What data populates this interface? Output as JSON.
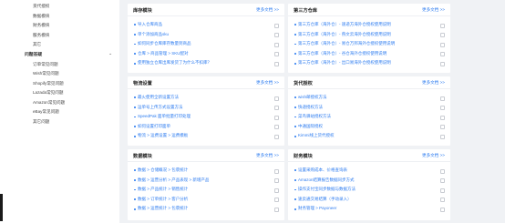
{
  "sidebar": {
    "top_items": [
      "货代授权",
      "数据模块",
      "财务模块",
      "服务模块",
      "其它"
    ],
    "group_label": "问题答疑",
    "group_items": [
      "订单常见问题",
      "Wish常见问题",
      "Shopify常见问题",
      "Lazada常见问题",
      "Amazon常见问题",
      "eBay常见问题",
      "其它问题"
    ]
  },
  "cards": [
    {
      "title": "库存模块",
      "more": "更多文档 >>",
      "rows": [
        "导入仓库商品",
        "单个添加商品sku",
        "如何同步仓库库存数量到商品",
        "仓库 > 商品管理 > SKU配对",
        "使用独立仓库出库发货了为什么不扣库？"
      ]
    },
    {
      "title": "第三方仓库",
      "more": "更多文档 >>",
      "rows": [
        "第三方仓库（海外仓）- 速递方海外仓授权使用说明",
        "第三方仓库（海外仓）- 燕文云海外仓授权使用说明",
        "第三方仓库（海外仓）- 易仓万邦海外仓授权使用说明",
        "第三方仓库（海外仓）- 谷仓海外仓授权使用说明",
        "第三方仓库（海外仓）- 出口易海外仓授权使用说明"
      ]
    },
    {
      "title": "物流设置",
      "more": "更多文档 >>",
      "rows": [
        "最火使用全新设置方法",
        "运单号上传方式设置方法",
        "SpeedPak 面单批量打印处理",
        "如何设置打印面单",
        "物流 > 运费设置 > 运费模板"
      ]
    },
    {
      "title": "货代授权",
      "more": "更多文档 >>",
      "rows": [
        "wish邮授权方法",
        "快递授权方法",
        "菜鸟驿站授权方法",
        "中通国际授权",
        "Kimmi线上货代授权"
      ]
    },
    {
      "title": "数据模块",
      "more": "更多文档 >>",
      "rows": [
        "数据 > 仓储概况 > 包裹统计",
        "数据 > 运营分析 > 产品表现 > 新增产品",
        "数据 > 产品统计 > 销售统计",
        "数据 > 订单统计 > 客户分析",
        "数据 > 运营统计 > 包裹统计"
      ]
    },
    {
      "title": "财务模块",
      "more": "更多文档 >>",
      "rows": [
        "设置采购成本、价格查询表",
        "Amazon结算报告数据同步方式",
        "操作支付宝同步数据与数据方法",
        "速卖通交易结算（手动录入）",
        "财务管理 > Payoneer"
      ]
    }
  ]
}
